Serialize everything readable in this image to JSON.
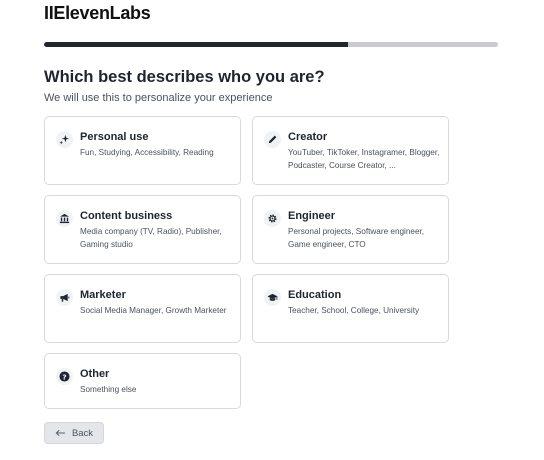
{
  "brand": {
    "logo": "IIElevenLabs"
  },
  "progress": {
    "fraction": 0.67
  },
  "heading": "Which best describes who you are?",
  "subtitle": "We will use this to personalize your experience",
  "options": [
    {
      "id": "personal-use",
      "icon": "sparkle-icon",
      "title": "Personal use",
      "desc": "Fun, Studying, Accessibility, Reading"
    },
    {
      "id": "creator",
      "icon": "pencil-icon",
      "title": "Creator",
      "desc": "YouTuber, TikToker, Instagramer, Blogger, Podcaster, Course Creator, ..."
    },
    {
      "id": "content-business",
      "icon": "bank-icon",
      "title": "Content business",
      "desc": "Media company (TV, Radio), Publisher, Gaming studio"
    },
    {
      "id": "engineer",
      "icon": "gear-icon",
      "title": "Engineer",
      "desc": "Personal projects, Software engineer, Game engineer, CTO"
    },
    {
      "id": "marketer",
      "icon": "megaphone-icon",
      "title": "Marketer",
      "desc": "Social Media Manager, Growth Marketer"
    },
    {
      "id": "education",
      "icon": "graduation-cap-icon",
      "title": "Education",
      "desc": "Teacher, School, College, University"
    },
    {
      "id": "other",
      "icon": "question-icon",
      "title": "Other",
      "desc": "Something else"
    }
  ],
  "back": {
    "label": "Back",
    "icon": "arrow-left-icon"
  },
  "colors": {
    "progress_fill": "#23252f",
    "progress_track": "#c8cad0",
    "card_border": "#d6d9df"
  }
}
